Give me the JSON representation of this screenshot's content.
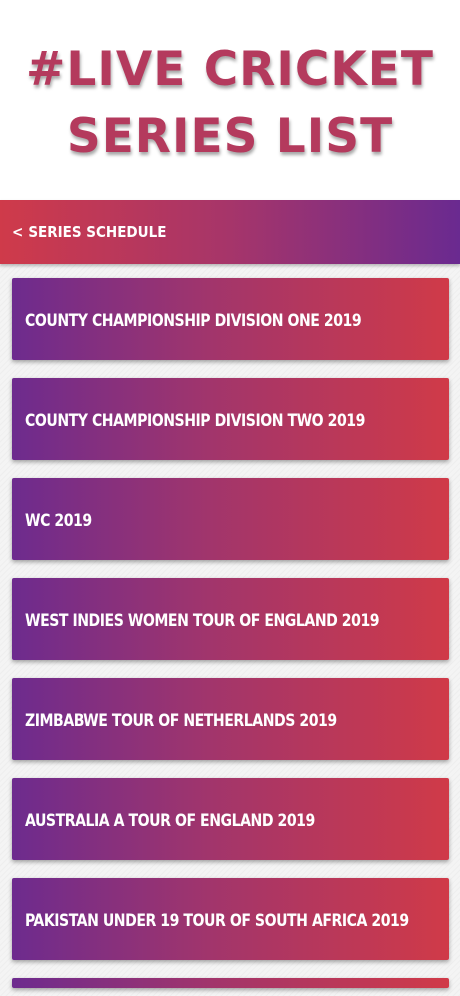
{
  "hero": {
    "line1": "#LIVE CRICKET",
    "line2": "SERIES LIST"
  },
  "header": {
    "back_icon": "chevron-left-icon",
    "back_glyph": "<",
    "title": "SERIES SCHEDULE"
  },
  "series": [
    {
      "label": "COUNTY CHAMPIONSHIP DIVISION ONE 2019"
    },
    {
      "label": "COUNTY CHAMPIONSHIP DIVISION TWO 2019"
    },
    {
      "label": "WC 2019"
    },
    {
      "label": "WEST INDIES WOMEN TOUR OF ENGLAND 2019"
    },
    {
      "label": "ZIMBABWE TOUR OF NETHERLANDS 2019"
    },
    {
      "label": "AUSTRALIA A TOUR OF ENGLAND 2019"
    },
    {
      "label": "PAKISTAN UNDER 19 TOUR OF SOUTH AFRICA 2019"
    }
  ],
  "colors": {
    "title": "#b43a5d",
    "gradient_purple": "#6d2b8e",
    "gradient_red": "#d03a48"
  }
}
